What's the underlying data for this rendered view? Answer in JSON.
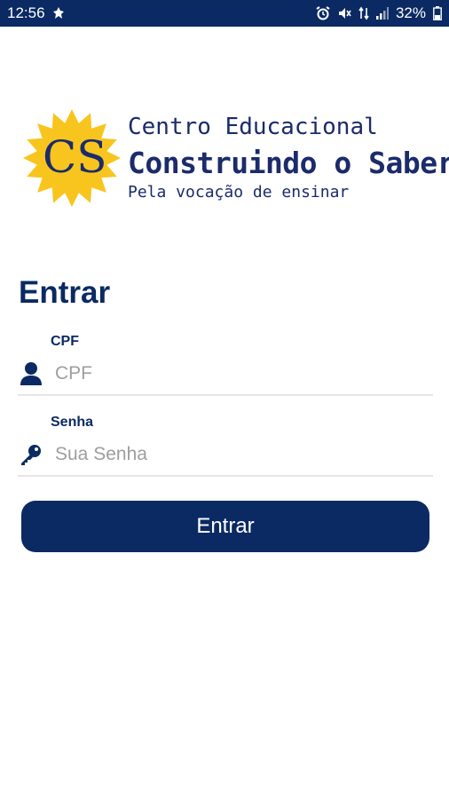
{
  "status_bar": {
    "time": "12:56",
    "battery": "32%"
  },
  "logo": {
    "monogram": "CS",
    "line1": "Centro Educacional",
    "line2": "Construindo o Saber",
    "tagline": "Pela vocação de ensinar"
  },
  "login": {
    "title": "Entrar",
    "cpf_label": "CPF",
    "cpf_placeholder": "CPF",
    "password_label": "Senha",
    "password_placeholder": "Sua Senha",
    "submit_label": "Entrar"
  },
  "colors": {
    "primary": "#0b2a63",
    "sun": "#f7c51e",
    "logo_text": "#1b2b6b"
  }
}
